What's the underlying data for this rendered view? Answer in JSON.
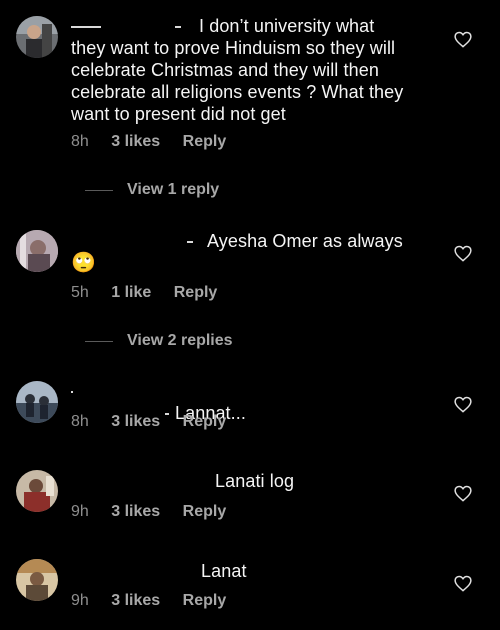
{
  "comments": [
    {
      "text_line1": "I don’t university what",
      "text_rest": "they want to prove Hinduism so they will celebrate Christmas and they will then celebrate all religions events ? What they want to present did not get",
      "time": "8h",
      "likes": "3 likes",
      "reply": "Reply",
      "view_replies": "View 1 reply",
      "avatar_icon": "user-avatar-icon"
    },
    {
      "text_line1": "Ayesha Omer as always",
      "emoji": "🙄",
      "time": "5h",
      "likes": "1 like",
      "reply": "Reply",
      "view_replies": "View 2 replies",
      "avatar_icon": "user-avatar-icon"
    },
    {
      "text_line1": "Lannat...",
      "time": "8h",
      "likes": "3 likes",
      "reply": "Reply",
      "avatar_icon": "user-avatar-icon"
    },
    {
      "text_line1": "Lanati log",
      "time": "9h",
      "likes": "3 likes",
      "reply": "Reply",
      "avatar_icon": "user-avatar-icon"
    },
    {
      "text_line1": "Lanat",
      "time": "9h",
      "likes": "3 likes",
      "reply": "Reply",
      "avatar_icon": "user-avatar-icon"
    }
  ],
  "colors": {
    "background": "#000000",
    "text": "#f5f5f5",
    "meta": "#a8a8a8",
    "heart": "#e0e0e0"
  },
  "icons": {
    "like": "heart-outline-icon"
  }
}
